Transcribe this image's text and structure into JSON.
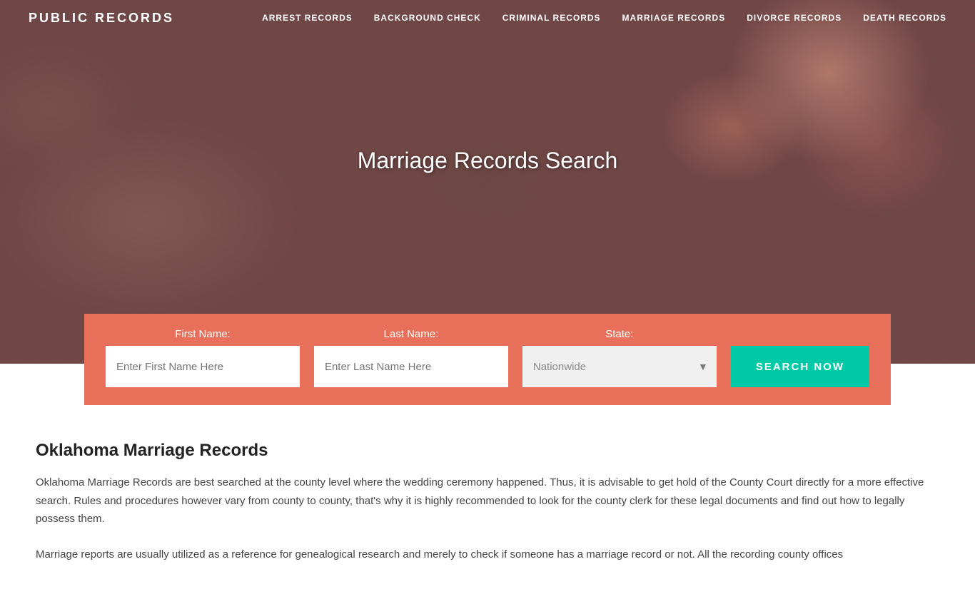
{
  "site": {
    "logo": "PUBLIC RECORDS"
  },
  "nav": {
    "items": [
      {
        "label": "ARREST RECORDS",
        "id": "arrest-records"
      },
      {
        "label": "BACKGROUND CHECK",
        "id": "background-check"
      },
      {
        "label": "CRIMINAL RECORDS",
        "id": "criminal-records"
      },
      {
        "label": "MARRIAGE RECORDS",
        "id": "marriage-records"
      },
      {
        "label": "DIVORCE RECORDS",
        "id": "divorce-records"
      },
      {
        "label": "DEATH RECORDS",
        "id": "death-records"
      }
    ]
  },
  "hero": {
    "title": "Marriage Records Search"
  },
  "search": {
    "first_name_label": "First Name:",
    "last_name_label": "Last Name:",
    "state_label": "State:",
    "first_name_placeholder": "Enter First Name Here",
    "last_name_placeholder": "Enter Last Name Here",
    "state_default": "Nationwide",
    "button_label": "SEARCH NOW",
    "chevron": "▼"
  },
  "content": {
    "title": "Oklahoma Marriage Records",
    "paragraph1": "Oklahoma Marriage Records are best searched at the county level where the wedding ceremony happened. Thus, it is advisable to get hold of the County Court directly for a more effective search. Rules and procedures however vary from county to county, that's why it is highly recommended to look for the county clerk for these legal documents and find out how to legally possess them.",
    "paragraph2": "Marriage reports are usually utilized as a reference for genealogical research and merely to check if someone has a marriage record or not. All the recording county offices"
  }
}
